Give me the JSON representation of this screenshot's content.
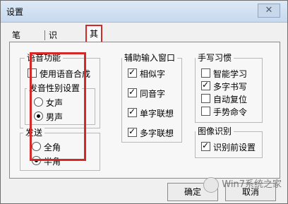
{
  "window": {
    "title": "设置",
    "close_glyph": "✕"
  },
  "tabs": [
    {
      "label": "笔设置",
      "active": false
    },
    {
      "label": "识别设置",
      "active": false
    },
    {
      "label": "其他设置",
      "active": true
    }
  ],
  "voice_group": {
    "title": "语音功能",
    "use_voice": {
      "label": "使用语音合成",
      "checked": false
    },
    "gender_group": {
      "title": "发音性别设置",
      "female": "女声",
      "male": "男声",
      "selected": "男声"
    }
  },
  "send_group": {
    "title": "发送",
    "full": "全角",
    "half": "半角",
    "selected": "半角"
  },
  "assist_group": {
    "title": "辅助输入窗口",
    "items": [
      {
        "label": "相似字",
        "checked": true
      },
      {
        "label": "同音字",
        "checked": true
      },
      {
        "label": "单字联想",
        "checked": true
      },
      {
        "label": "多字联想",
        "checked": true
      }
    ]
  },
  "habit_group": {
    "title": "手写习惯",
    "items": [
      {
        "label": "智能学习",
        "checked": false
      },
      {
        "label": "多字书写",
        "checked": true
      },
      {
        "label": "自动复位",
        "checked": false
      },
      {
        "label": "手势命令",
        "checked": false
      }
    ]
  },
  "image_group": {
    "title": "图像识别",
    "item": {
      "label": "识别前设置",
      "checked": true
    }
  },
  "buttons": {
    "ok": "确定",
    "cancel": "取消"
  },
  "watermark": {
    "text": "Win7系统之家"
  },
  "colors": {
    "highlight": "#d72828"
  }
}
